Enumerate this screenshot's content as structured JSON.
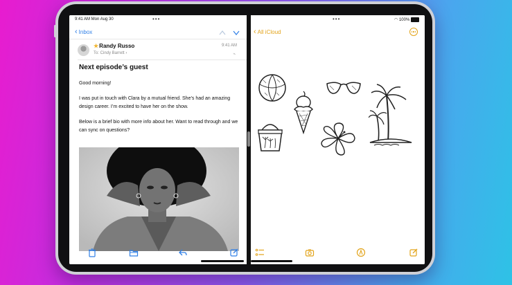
{
  "status_bar": {
    "time_date": "9:41 AM  Mon Aug 30",
    "battery": "100%"
  },
  "mail": {
    "back_label": "Inbox",
    "sender": "Randy Russo",
    "to_line": "To: Cindy Barrett",
    "time": "9:41 AM",
    "subject": "Next episode’s guest",
    "paragraphs": [
      "Good morning!",
      "I was put in touch with Clara by a mutual friend. She’s had an amazing design career. I’m excited to have her on the show.",
      "Below is a brief bio with more info about her. Want to read through and we can sync on questions?"
    ],
    "toolbar": [
      "trash-icon",
      "folder-icon",
      "reply-icon",
      "compose-icon"
    ]
  },
  "notes": {
    "back_label": "All iCloud",
    "sketches": [
      "beach-ball",
      "ice-cream",
      "sunglasses",
      "palm-trees",
      "bucket",
      "hibiscus"
    ],
    "toolbar": [
      "checklist-icon",
      "camera-icon",
      "markup-icon",
      "compose-icon"
    ]
  },
  "colors": {
    "mail_accent": "#2f7fe6",
    "notes_accent": "#e2a319",
    "star": "#f2b530"
  }
}
